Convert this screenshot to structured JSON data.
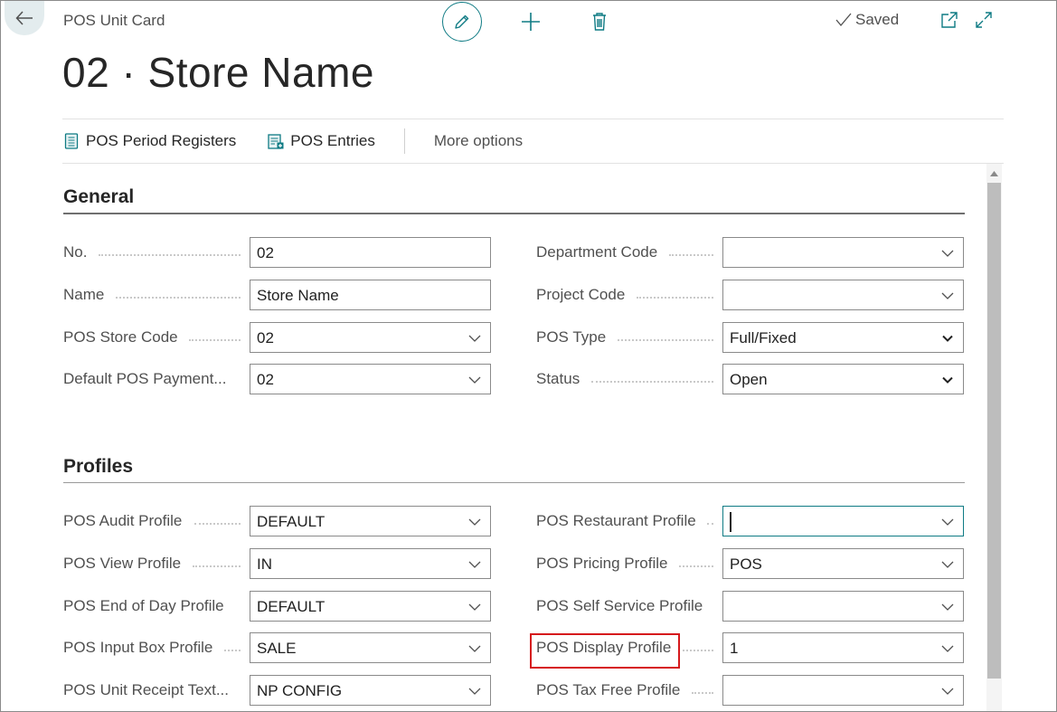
{
  "header": {
    "breadcrumb": "POS Unit Card",
    "title": "02 · Store Name",
    "saved_label": "Saved"
  },
  "actions": [
    {
      "label": "POS Period Registers",
      "icon": "register-book-icon"
    },
    {
      "label": "POS Entries",
      "icon": "entries-list-icon"
    }
  ],
  "more_options": "More options",
  "sections": {
    "general": {
      "title": "General",
      "left": [
        {
          "label": "No.",
          "value": "02",
          "type": "text"
        },
        {
          "label": "Name",
          "value": "Store Name",
          "type": "text"
        },
        {
          "label": "POS Store Code",
          "value": "02",
          "type": "lookup"
        },
        {
          "label": "Default POS Payment...",
          "value": "02",
          "type": "lookup"
        }
      ],
      "right": [
        {
          "label": "Department Code",
          "value": "",
          "type": "lookup"
        },
        {
          "label": "Project Code",
          "value": "",
          "type": "lookup"
        },
        {
          "label": "POS Type",
          "value": "Full/Fixed",
          "type": "select"
        },
        {
          "label": "Status",
          "value": "Open",
          "type": "select"
        }
      ]
    },
    "profiles": {
      "title": "Profiles",
      "left": [
        {
          "label": "POS Audit Profile",
          "value": "DEFAULT",
          "type": "lookup"
        },
        {
          "label": "POS View Profile",
          "value": "IN",
          "type": "lookup"
        },
        {
          "label": "POS End of Day Profile",
          "value": "DEFAULT",
          "type": "lookup"
        },
        {
          "label": "POS Input Box Profile",
          "value": "SALE",
          "type": "lookup"
        },
        {
          "label": "POS Unit Receipt Text...",
          "value": "NP CONFIG",
          "type": "lookup"
        }
      ],
      "right": [
        {
          "label": "POS Restaurant Profile",
          "value": "",
          "type": "lookup",
          "focused": true
        },
        {
          "label": "POS Pricing Profile",
          "value": "POS",
          "type": "lookup"
        },
        {
          "label": "POS Self Service Profile",
          "value": "",
          "type": "lookup"
        },
        {
          "label": "POS Display Profile",
          "value": "1",
          "type": "lookup",
          "highlighted": true
        },
        {
          "label": "POS Tax Free Profile",
          "value": "",
          "type": "lookup"
        }
      ]
    }
  },
  "colors": {
    "accent": "#0f7b84",
    "highlight": "#d6191c",
    "label": "#505050"
  }
}
